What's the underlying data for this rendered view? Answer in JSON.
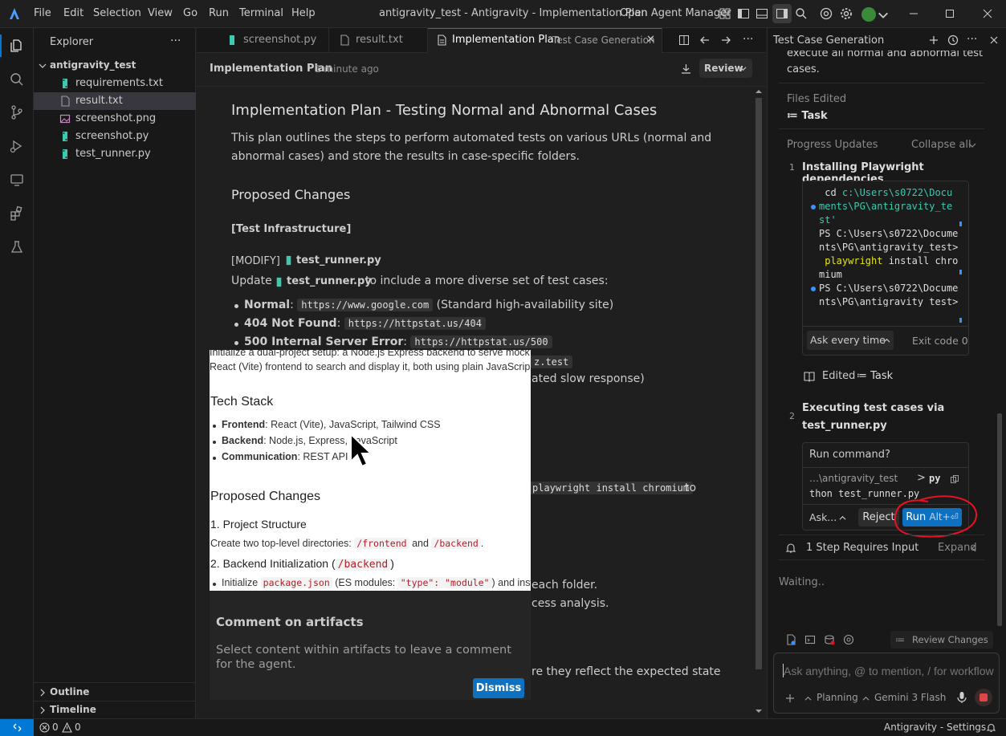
{
  "titlebar": {
    "menus": [
      "File",
      "Edit",
      "Selection",
      "View",
      "Go",
      "Run",
      "Terminal",
      "Help"
    ],
    "window_title": "antigravity_test - Antigravity - Implementation Plan",
    "open_agent_manager": "Open Agent Manager"
  },
  "explorer": {
    "title": "Explorer",
    "more": "···",
    "folder": "antigravity_test",
    "files": [
      {
        "name": "requirements.txt",
        "kind": "python"
      },
      {
        "name": "result.txt",
        "kind": "text"
      },
      {
        "name": "screenshot.png",
        "kind": "image"
      },
      {
        "name": "screenshot.py",
        "kind": "python"
      },
      {
        "name": "test_runner.py",
        "kind": "python"
      }
    ],
    "outline": "Outline",
    "timeline": "Timeline"
  },
  "tabs": [
    {
      "label": "screenshot.py"
    },
    {
      "label": "result.txt"
    },
    {
      "label": "Implementation Plan",
      "sub": "Test Case Generation",
      "close": "✕"
    }
  ],
  "editor": {
    "header_title": "Implementation Plan",
    "header_time": "1 minute ago",
    "review": "Review",
    "h1": "Implementation Plan - Testing Normal and Abnormal Cases",
    "intro": "This plan outlines the steps to perform automated tests on various URLs (normal and abnormal cases) and store the results in case-specific folders.",
    "proposed_changes": "Proposed Changes",
    "test_infra": "[Test Infrastructure]",
    "modify": "[MODIFY]",
    "file": "test_runner.py",
    "update_pre": "Update",
    "update_post": "to include a more diverse set of test cases:",
    "cases": [
      {
        "label": "Normal",
        "url": "https://www.google.com",
        "note": "(Standard high-availability site)"
      },
      {
        "label": "404 Not Found",
        "url": "https://httpstat.us/404",
        "note": ""
      },
      {
        "label": "500 Internal Server Error",
        "url": "https://httpstat.us/500",
        "note": ""
      }
    ],
    "frag_code1": "z.test",
    "frag_slow": "ated slow response)",
    "frag_playwright": "playwright install chromium",
    "frag_to": "to",
    "frag_each": "each folder.",
    "frag_analysis": "cess analysis.",
    "frag_state": "re they reflect the expected state"
  },
  "preview": {
    "line1": "Initialize a dual-project setup: a Node.js Express backend to serve mock",
    "line2": "React (Vite) frontend to search and display it, both using plain JavaScrip",
    "tech_stack": "Tech Stack",
    "stack": [
      {
        "k": "Frontend",
        "v": ": React (Vite), JavaScript, Tailwind CSS"
      },
      {
        "k": "Backend",
        "v": ": Node.js, Express, JavaScript"
      },
      {
        "k": "Communication",
        "v": ": REST API"
      }
    ],
    "proposed": "Proposed Changes",
    "s1": "1. Project Structure",
    "s1_pre": "Create two top-level directories:",
    "s1_c1": "/frontend",
    "s1_and": "and",
    "s1_c2": "/backend",
    "s2_pre": "2. Backend Initialization (",
    "s2_code": "/backend",
    "s2_post": ")",
    "s3_pre": "Initialize",
    "s3_c1": "package.json",
    "s3_mid": "(ES modules:",
    "s3_c2": "\"type\": \"module\"",
    "s3_post": ") and insta"
  },
  "comment": {
    "title": "Comment on artifacts",
    "body": "Select content within artifacts to leave a comment for the agent.",
    "dismiss": "Dismiss"
  },
  "right": {
    "title": "Test Case Generation",
    "top_text_1": "execute all normal and abnormal test",
    "top_text_2": "cases.",
    "files_edited": "Files Edited",
    "task": "Task",
    "progress": "Progress Updates",
    "collapse": "Collapse all",
    "step1_num": "1",
    "step1": "Installing Playwright dependencies",
    "terminal": [
      {
        "text": " cd ",
        "hl": "c:\\Users\\s0722\\Docu"
      },
      {
        "text": "",
        "hl": "ments\\PG\\antigravity_te"
      },
      {
        "text": "",
        "hl": "st'"
      },
      {
        "text": "PS C:\\Users\\s0722\\Docume"
      },
      {
        "text": "nts\\PG\\antigravity_test>"
      },
      {
        "text": " ",
        "kw": "playwright",
        "rest": " install chro"
      },
      {
        "text": "mium"
      },
      {
        "text": "PS C:\\Users\\s0722\\Docume"
      },
      {
        "text": "nts\\PG\\antigravity_test>"
      }
    ],
    "ask_every_time": "Ask every time",
    "exit_code": "Exit code 0",
    "edited": "Edited",
    "step2_num": "2",
    "step2_line1": "Executing test cases via",
    "step2_line2": "test_runner.py",
    "run_command": "Run command?",
    "cmd_path": "…\\antigravity_test",
    "cmd_prompt": ">",
    "cmd_1": "py",
    "cmd_2": "thon test_runner.py",
    "ask": "Ask...",
    "reject": "Reject",
    "run": "Run",
    "run_shortcut": "Alt+⏎",
    "requires_input": "1 Step Requires Input",
    "expand": "Expand",
    "waiting": "Waiting..",
    "review_changes": "Review Changes",
    "ask_placeholder": "Ask anything, @ to mention, / for workflows",
    "planning": "Planning",
    "model": "Gemini 3 Flash"
  },
  "status": {
    "errors": "0",
    "warnings": "0",
    "settings": "Antigravity - Settings"
  },
  "colors": {
    "accent": "#0078d4",
    "run_button": "#0e70c0",
    "python": "#3dc9b0",
    "annotation_red": "#e81123"
  }
}
